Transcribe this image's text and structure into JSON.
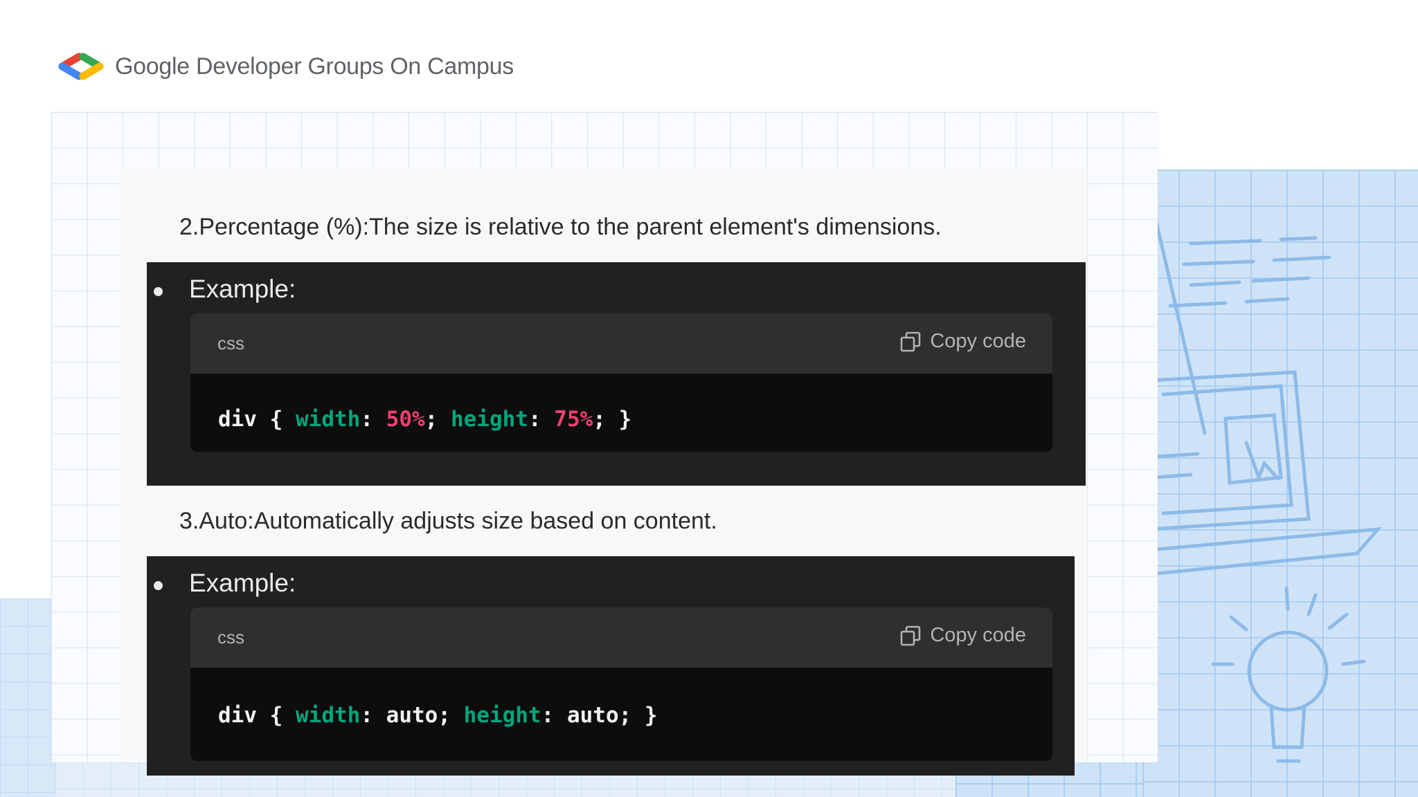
{
  "header": {
    "brand": "Google Developer Groups On Campus"
  },
  "sections": [
    {
      "heading": "2.Percentage (%):The size is relative to the parent element's dimensions.",
      "example_label": "Example:",
      "code": {
        "lang": "css",
        "copy_label": "Copy code",
        "tokens": [
          "div",
          " { ",
          "width",
          ": ",
          "50%",
          "; ",
          "height",
          ": ",
          "75%",
          "; }"
        ]
      }
    },
    {
      "heading": "3.Auto:Automatically adjusts size based on content.",
      "example_label": "Example:",
      "code": {
        "lang": "css",
        "copy_label": "Copy code",
        "tokens": [
          "div",
          " { ",
          "width",
          ": ",
          "auto",
          "; ",
          "height",
          ": ",
          "auto",
          "; }"
        ]
      }
    }
  ],
  "colors": {
    "logo_red": "#ea4335",
    "logo_blue": "#4285f4",
    "logo_green": "#34a853",
    "logo_yellow": "#fbbc04",
    "code_property": "#00a67d",
    "code_number": "#e9426f",
    "panel_bg": "#212121",
    "code_header_bg": "#2f2f2f"
  },
  "icons": [
    "gdg-logo-icon",
    "copy-icon",
    "bullet-icon"
  ]
}
